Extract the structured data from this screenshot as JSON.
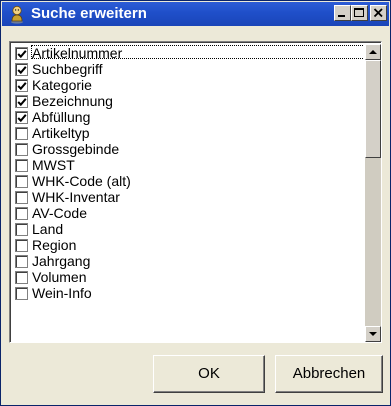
{
  "window": {
    "title": "Suche erweitern",
    "icon": "person-search-icon",
    "controls": [
      "minimize-icon",
      "maximize-icon",
      "close-icon"
    ]
  },
  "list": {
    "items": [
      {
        "label": "Artikelnummer",
        "checked": true,
        "focused": true
      },
      {
        "label": "Suchbegriff",
        "checked": true
      },
      {
        "label": "Kategorie",
        "checked": true
      },
      {
        "label": "Bezeichnung",
        "checked": true
      },
      {
        "label": "Abfüllung",
        "checked": true
      },
      {
        "label": "Artikeltyp",
        "checked": false
      },
      {
        "label": "Grossgebinde",
        "checked": false
      },
      {
        "label": "MWST",
        "checked": false
      },
      {
        "label": "WHK-Code (alt)",
        "checked": false
      },
      {
        "label": "WHK-Inventar",
        "checked": false
      },
      {
        "label": "AV-Code",
        "checked": false
      },
      {
        "label": "Land",
        "checked": false
      },
      {
        "label": "Region",
        "checked": false
      },
      {
        "label": "Jahrgang",
        "checked": false
      },
      {
        "label": "Volumen",
        "checked": false
      },
      {
        "label": "Wein-Info",
        "checked": false
      }
    ]
  },
  "buttons": {
    "ok_label": "OK",
    "cancel_label": "Abbrechen"
  }
}
